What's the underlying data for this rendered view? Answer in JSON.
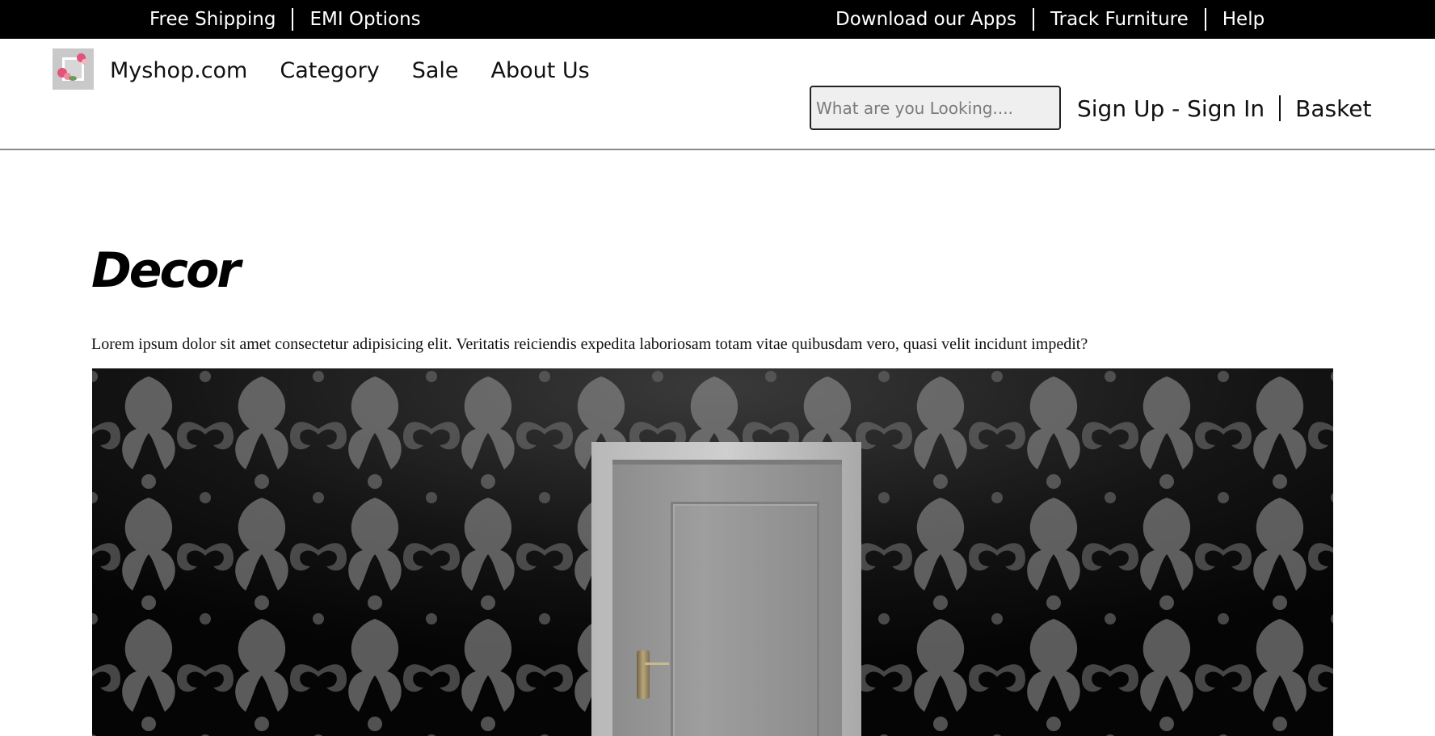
{
  "topbar": {
    "left_links": [
      "Free Shipping",
      "EMI Options"
    ],
    "right_links": [
      "Download our Apps",
      "Track Furniture",
      "Help"
    ]
  },
  "navbar": {
    "brand": "Myshop.com",
    "links": [
      "Category",
      "Sale",
      "About Us"
    ],
    "search": {
      "placeholder": "What are you Looking....",
      "value": ""
    },
    "account": {
      "signin": "Sign Up - Sign In",
      "basket": "Basket"
    }
  },
  "main": {
    "title": "Decor",
    "description": "Lorem ipsum dolor sit amet consectetur adipisicing elit. Veritatis reiciendis expedita laboriosam totam vitae quibusdam vero, quasi velit incidunt impedit?"
  },
  "colors": {
    "topbar_bg": "#000000",
    "page_bg": "#ffffff",
    "divider": "#8a8a8a"
  }
}
